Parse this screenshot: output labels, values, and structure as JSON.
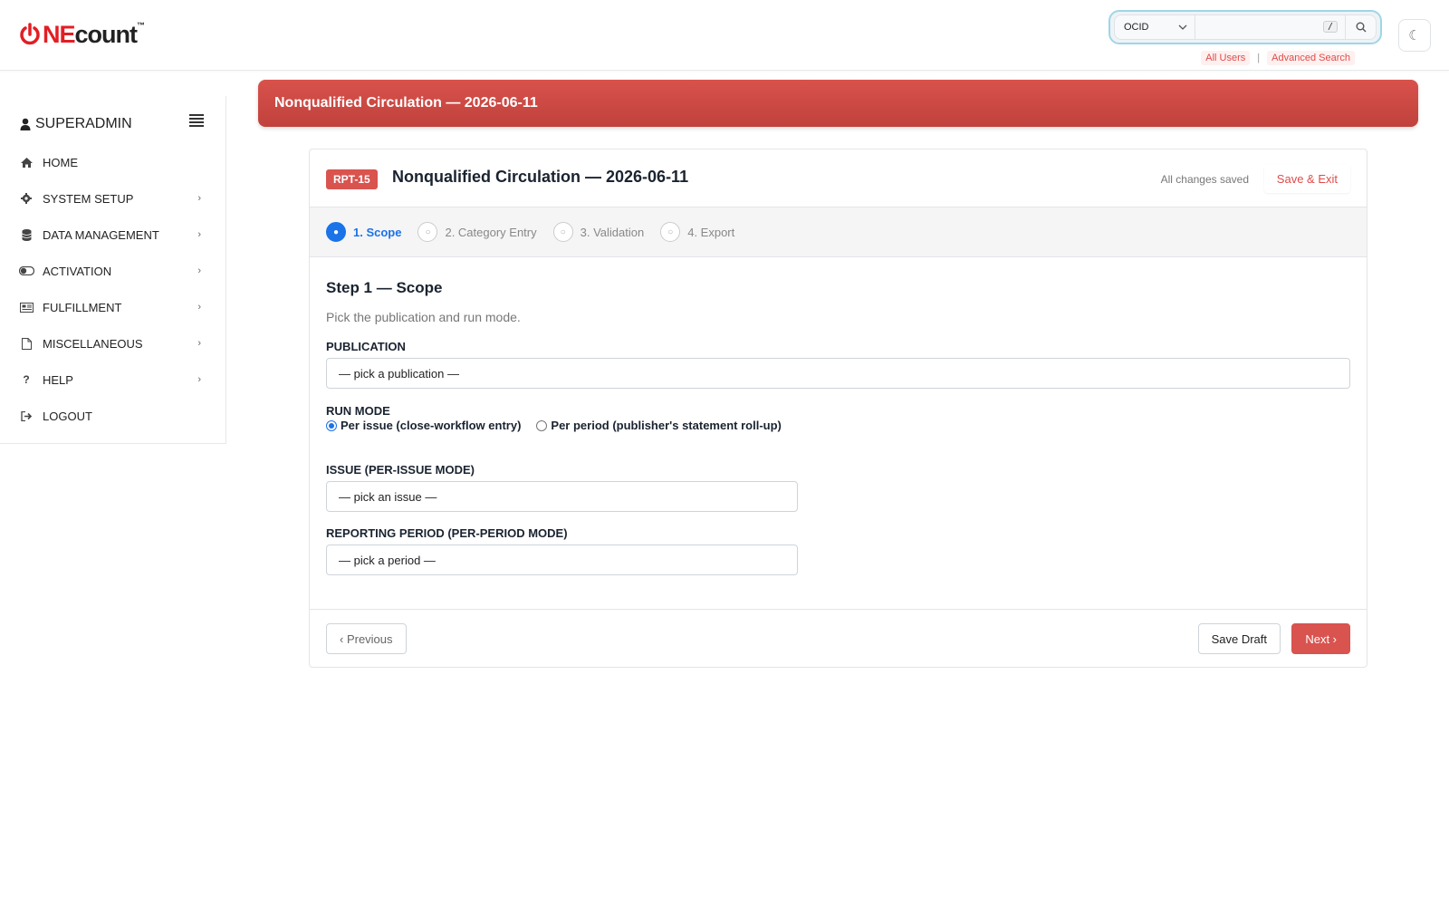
{
  "brand": {
    "one": "NE",
    "count": "count",
    "tm": "™"
  },
  "search": {
    "scope": "OCID",
    "shortcut": "/",
    "links": [
      "All Users",
      "Advanced Search"
    ],
    "separator": "|"
  },
  "theme_toggle": "☾",
  "sidebar": {
    "user": "SUPERADMIN",
    "items": [
      {
        "label": "HOME",
        "icon": "home-icon",
        "has_sub": false
      },
      {
        "label": "SYSTEM SETUP",
        "icon": "gear-icon",
        "has_sub": true
      },
      {
        "label": "DATA MANAGEMENT",
        "icon": "database-icon",
        "has_sub": true
      },
      {
        "label": "ACTIVATION",
        "icon": "toggle-icon",
        "has_sub": true
      },
      {
        "label": "FULFILLMENT",
        "icon": "newspaper-icon",
        "has_sub": true
      },
      {
        "label": "MISCELLANEOUS",
        "icon": "file-icon",
        "has_sub": true
      },
      {
        "label": "HELP",
        "icon": "question-icon",
        "has_sub": true
      },
      {
        "label": "LOGOUT",
        "icon": "sign-out-icon",
        "has_sub": false
      }
    ]
  },
  "banner": {
    "title": "Nonqualified Circulation — 2026-06-11"
  },
  "card": {
    "badge": "RPT-15",
    "title": "Nonqualified Circulation — 2026-06-11",
    "saved_status": "All changes saved",
    "save_exit": "Save & Exit",
    "steps": [
      {
        "label": "1. Scope",
        "active": true
      },
      {
        "label": "2. Category Entry",
        "active": false
      },
      {
        "label": "3. Validation",
        "active": false
      },
      {
        "label": "4. Export",
        "active": false
      }
    ],
    "step_heading": "Step 1 — Scope",
    "step_sub": "Pick the publication and run mode.",
    "publication": {
      "label": "PUBLICATION",
      "value": "— pick a publication —"
    },
    "run_mode": {
      "label": "RUN MODE",
      "options": [
        {
          "label": "Per issue (close-workflow entry)",
          "checked": true
        },
        {
          "label": "Per period (publisher's statement roll-up)",
          "checked": false
        }
      ]
    },
    "issue": {
      "label": "ISSUE (PER-ISSUE MODE)",
      "value": "— pick an issue —"
    },
    "period": {
      "label": "REPORTING PERIOD (PER-PERIOD MODE)",
      "value": "— pick a period —"
    },
    "buttons": {
      "previous": "‹ Previous",
      "save_draft": "Save Draft",
      "next": "Next ›"
    }
  },
  "colors": {
    "brand_red": "#e31e24",
    "accent_red": "#d9534f",
    "active_blue": "#1a73e8"
  }
}
